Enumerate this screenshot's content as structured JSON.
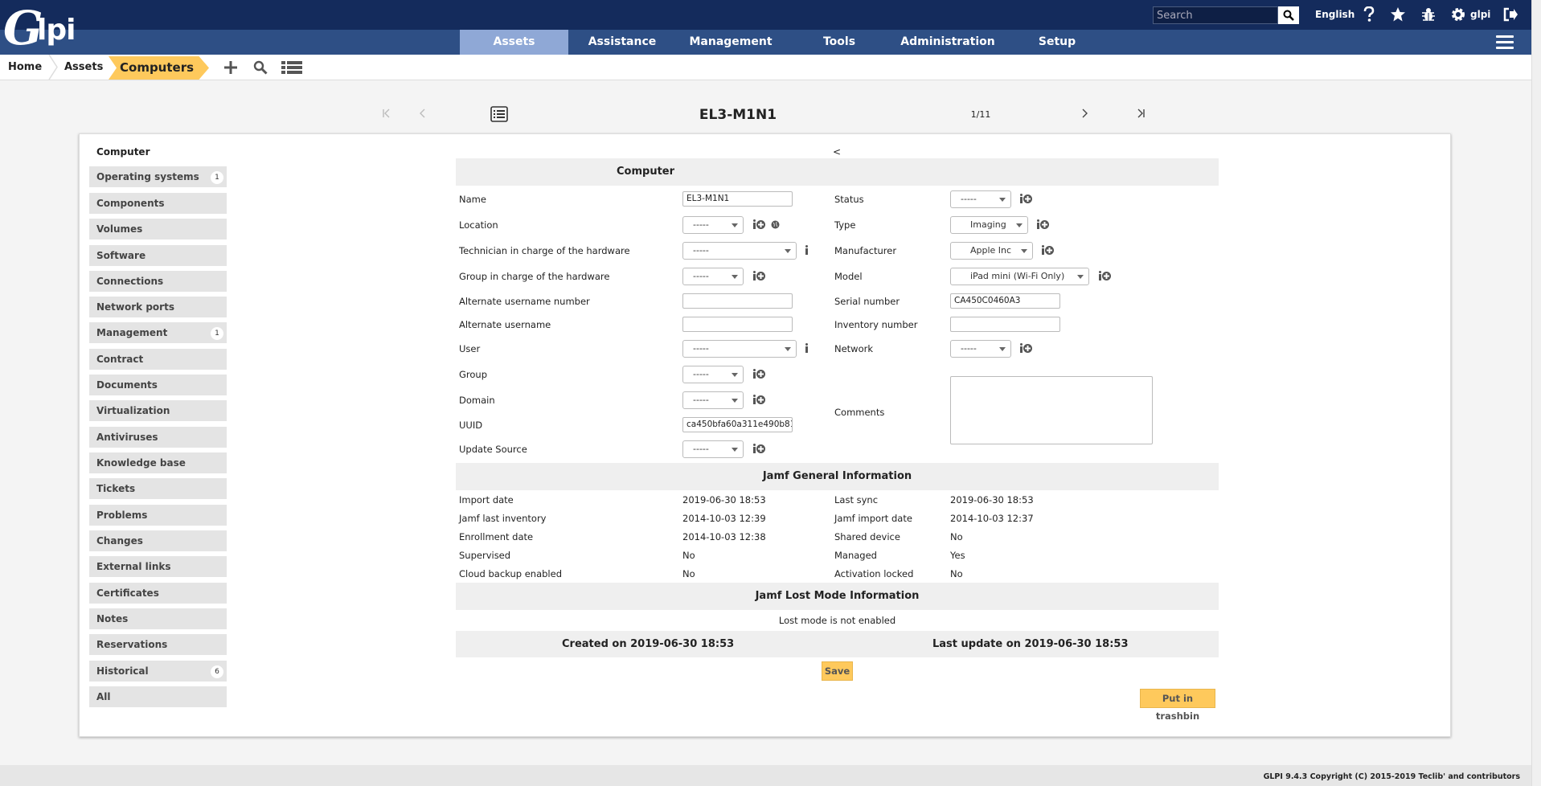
{
  "app": {
    "logo_letter": "G",
    "logo_text": "lpi"
  },
  "header": {
    "search_placeholder": "Search",
    "language": "English",
    "user": "glpi",
    "menu": [
      "Assets",
      "Assistance",
      "Management",
      "Tools",
      "Administration",
      "Setup"
    ],
    "active_menu": "Assets"
  },
  "breadcrumb": {
    "home": "Home",
    "assets": "Assets",
    "current": "Computers"
  },
  "pager": {
    "title": "EL3-M1N1",
    "count": "1/11"
  },
  "tabs": {
    "heading": "Computer",
    "items": [
      {
        "label": "Operating systems",
        "badge": "1"
      },
      {
        "label": "Components",
        "badge": ""
      },
      {
        "label": "Volumes",
        "badge": ""
      },
      {
        "label": "Software",
        "badge": ""
      },
      {
        "label": "Connections",
        "badge": ""
      },
      {
        "label": "Network ports",
        "badge": ""
      },
      {
        "label": "Management",
        "badge": "1"
      },
      {
        "label": "Contract",
        "badge": ""
      },
      {
        "label": "Documents",
        "badge": ""
      },
      {
        "label": "Virtualization",
        "badge": ""
      },
      {
        "label": "Antiviruses",
        "badge": ""
      },
      {
        "label": "Knowledge base",
        "badge": ""
      },
      {
        "label": "Tickets",
        "badge": ""
      },
      {
        "label": "Problems",
        "badge": ""
      },
      {
        "label": "Changes",
        "badge": ""
      },
      {
        "label": "External links",
        "badge": ""
      },
      {
        "label": "Certificates",
        "badge": ""
      },
      {
        "label": "Notes",
        "badge": ""
      },
      {
        "label": "Reservations",
        "badge": ""
      },
      {
        "label": "Historical",
        "badge": "6"
      },
      {
        "label": "All",
        "badge": ""
      }
    ]
  },
  "form": {
    "collapse": "<",
    "section_title": "Computer",
    "name_label": "Name",
    "name_value": "EL3-M1N1",
    "location_label": "Location",
    "location_value": "-----",
    "tech_label": "Technician in charge of the hardware",
    "tech_value": "-----",
    "group_hw_label": "Group in charge of the hardware",
    "group_hw_value": "-----",
    "alt_num_label": "Alternate username number",
    "alt_num_value": "",
    "alt_user_label": "Alternate username",
    "alt_user_value": "",
    "user_label": "User",
    "user_value": "-----",
    "group_label": "Group",
    "group_value": "-----",
    "domain_label": "Domain",
    "domain_value": "-----",
    "uuid_label": "UUID",
    "uuid_value": "ca450bfa60a311e490b81",
    "update_label": "Update Source",
    "update_value": "-----",
    "status_label": "Status",
    "status_value": "-----",
    "type_label": "Type",
    "type_value": "Imaging",
    "manufacturer_label": "Manufacturer",
    "manufacturer_value": "Apple Inc",
    "model_label": "Model",
    "model_value": "iPad mini (Wi-Fi Only)",
    "serial_label": "Serial number",
    "serial_value": "CA450C0460A3",
    "inventory_label": "Inventory number",
    "inventory_value": "",
    "network_label": "Network",
    "network_value": "-----",
    "comments_label": "Comments"
  },
  "jamf": {
    "title": "Jamf General Information",
    "import_date_label": "Import date",
    "import_date": "2019-06-30 18:53",
    "last_inventory_label": "Jamf last inventory",
    "last_inventory": "2014-10-03 12:39",
    "enrollment_label": "Enrollment date",
    "enrollment": "2014-10-03 12:38",
    "supervised_label": "Supervised",
    "supervised": "No",
    "cloud_label": "Cloud backup enabled",
    "cloud": "No",
    "last_sync_label": "Last sync",
    "last_sync": "2019-06-30 18:53",
    "jamf_import_label": "Jamf import date",
    "jamf_import": "2014-10-03 12:37",
    "shared_label": "Shared device",
    "shared": "No",
    "managed_label": "Managed",
    "managed": "Yes",
    "activation_label": "Activation locked",
    "activation": "No"
  },
  "lost_mode": {
    "title": "Jamf Lost Mode Information",
    "message": "Lost mode is not enabled"
  },
  "dates": {
    "created": "Created on 2019-06-30 18:53",
    "updated": "Last update on 2019-06-30 18:53"
  },
  "buttons": {
    "save": "Save",
    "trash": "Put in trashbin"
  },
  "footer": "GLPI 9.4.3 Copyright (C) 2015-2019 Teclib' and contributors",
  "colors": {
    "topbar": "#142b5c",
    "navbar": "#2e4f85",
    "active_menu": "#8fa8d6",
    "accent": "#fec95c"
  }
}
